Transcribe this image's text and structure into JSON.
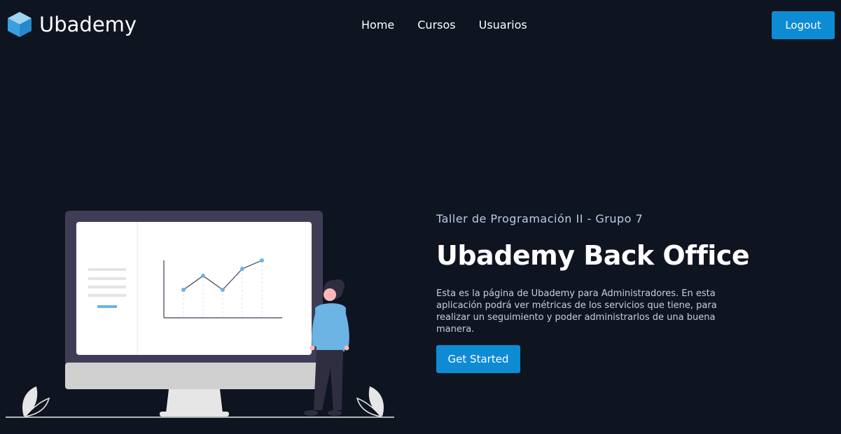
{
  "header": {
    "brand": "Ubademy",
    "nav": [
      {
        "label": "Home"
      },
      {
        "label": "Cursos"
      },
      {
        "label": "Usuarios"
      }
    ],
    "logout_label": "Logout"
  },
  "hero": {
    "subtitle": "Taller de Programación II - Grupo 7",
    "title": "Ubademy Back Office",
    "description": "Esta es la página de Ubademy para Administradores. En esta aplicación podrá ver métricas de los servicios que tiene, para realizar un seguimiento y poder administrarlos de una buena manera.",
    "cta_label": "Get Started"
  },
  "icons": {
    "logo": "cube-logo-icon"
  },
  "colors": {
    "background": "#0f1421",
    "accent": "#0d8bd3",
    "subtitle": "#b9cde4",
    "illustration_blue": "#6bb4e4"
  }
}
